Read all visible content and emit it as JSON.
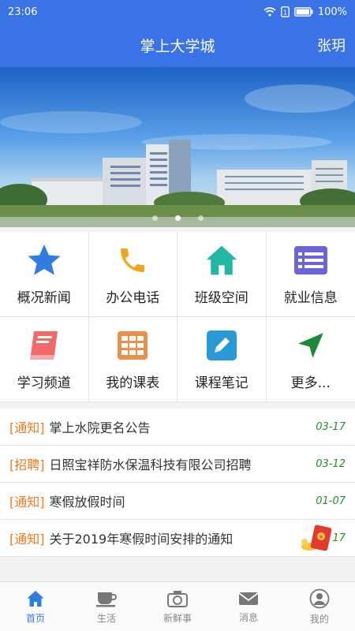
{
  "status": {
    "time": "23:06",
    "battery": "100%"
  },
  "header": {
    "title": "掌上大学城",
    "user": "张玥"
  },
  "banner": {
    "slides": 3,
    "active": 2
  },
  "grid": [
    {
      "label": "概况新闻",
      "icon": "star-icon"
    },
    {
      "label": "办公电话",
      "icon": "phone-icon"
    },
    {
      "label": "班级空间",
      "icon": "house-icon"
    },
    {
      "label": "就业信息",
      "icon": "list-card-icon"
    },
    {
      "label": "学习频道",
      "icon": "book-icon"
    },
    {
      "label": "我的课表",
      "icon": "timetable-icon"
    },
    {
      "label": "课程笔记",
      "icon": "pencil-icon"
    },
    {
      "label": "更多...",
      "icon": "navigation-arrow-icon"
    }
  ],
  "news": [
    {
      "tag": "[通知]",
      "title": "掌上水院更名公告",
      "date": "03-17"
    },
    {
      "tag": "[招聘]",
      "title": "日照宝祥防水保温科技有限公司招聘",
      "date": "03-12"
    },
    {
      "tag": "[通知]",
      "title": "寒假放假时间",
      "date": "01-07"
    },
    {
      "tag": "[通知]",
      "title": "关于2019年寒假时间安排的通知",
      "date": "17"
    }
  ],
  "tabs": [
    {
      "label": "首页",
      "icon": "home-icon",
      "active": true
    },
    {
      "label": "生活",
      "icon": "coffee-cup-icon",
      "active": false
    },
    {
      "label": "新鲜事",
      "icon": "camera-icon",
      "active": false
    },
    {
      "label": "消息",
      "icon": "envelope-icon",
      "active": false
    },
    {
      "label": "我的",
      "icon": "user-icon",
      "active": false
    }
  ],
  "colors": {
    "primary": "#3a73e6",
    "tag": "#f07a1e",
    "date": "#2a8a2a",
    "tab_active": "#2f7de1"
  }
}
